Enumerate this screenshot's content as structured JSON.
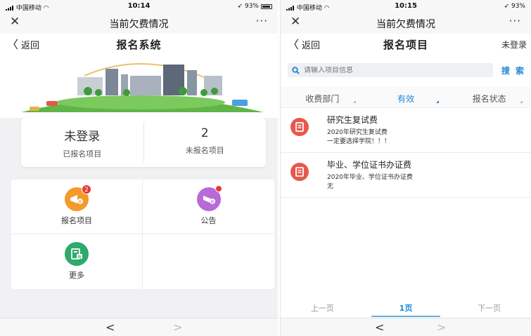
{
  "left": {
    "status": {
      "carrier": "中国移动",
      "time": "10:14",
      "battery": "93%"
    },
    "nav": {
      "close": "✕",
      "title": "当前欠费情况",
      "more": "···"
    },
    "header": {
      "back": "返回",
      "title": "报名系统"
    },
    "stats": [
      {
        "value": "未登录",
        "label": "已报名项目"
      },
      {
        "value": "2",
        "label": "未报名项目"
      }
    ],
    "menu": [
      {
        "label": "报名项目",
        "badge": "2",
        "color": "#f39a2a",
        "icon": "megaphone-icon",
        "glyph": "报"
      },
      {
        "label": "公告",
        "color": "#b86ad8",
        "icon": "notice-icon",
        "glyph": "报"
      },
      {
        "label": "更多",
        "color": "#2eaa6b",
        "icon": "more-apps-icon",
        "glyph": "精"
      }
    ],
    "bottom": {
      "back": "<",
      "forward": ">"
    }
  },
  "right": {
    "status": {
      "carrier": "中国移动",
      "time": "10:15",
      "battery": "93%"
    },
    "nav": {
      "close": "✕",
      "title": "当前欠费情况",
      "more": "···"
    },
    "header": {
      "back": "返回",
      "title": "报名项目",
      "login": "未登录"
    },
    "search": {
      "placeholder": "请输入项目信息",
      "button": "搜 索"
    },
    "filters": [
      {
        "label": "收费部门",
        "active": false
      },
      {
        "label": "有效",
        "active": true
      },
      {
        "label": "报名状态",
        "active": false
      }
    ],
    "items": [
      {
        "title": "研究生复试费",
        "line1": "2020年研究生复试费",
        "line2": "一定要选择学院！！！"
      },
      {
        "title": "毕业、学位证书办证费",
        "line1": "2020年毕业、学位证书办证费",
        "line2": "无"
      }
    ],
    "pager": {
      "prev": "上一页",
      "current": "1页",
      "next": "下一页"
    },
    "bottom": {
      "back": "<",
      "forward": ">"
    }
  },
  "colors": {
    "accent": "#1e8ad6",
    "danger": "#e8584c"
  }
}
